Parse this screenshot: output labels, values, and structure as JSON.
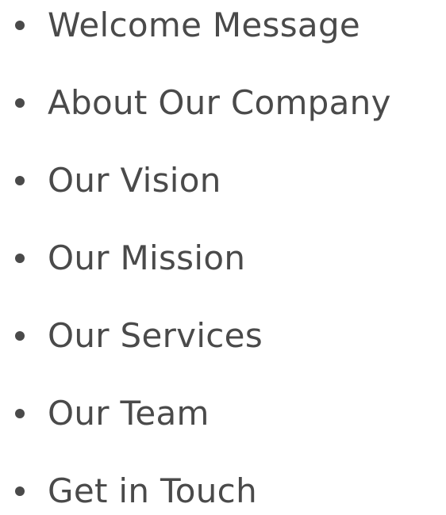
{
  "nav": {
    "items": [
      {
        "label": "Welcome Message"
      },
      {
        "label": "About Our Company"
      },
      {
        "label": "Our Vision"
      },
      {
        "label": "Our Mission"
      },
      {
        "label": "Our Services"
      },
      {
        "label": "Our Team"
      },
      {
        "label": "Get in Touch"
      }
    ]
  },
  "colors": {
    "text": "#4a4a4a",
    "background": "#ffffff"
  }
}
